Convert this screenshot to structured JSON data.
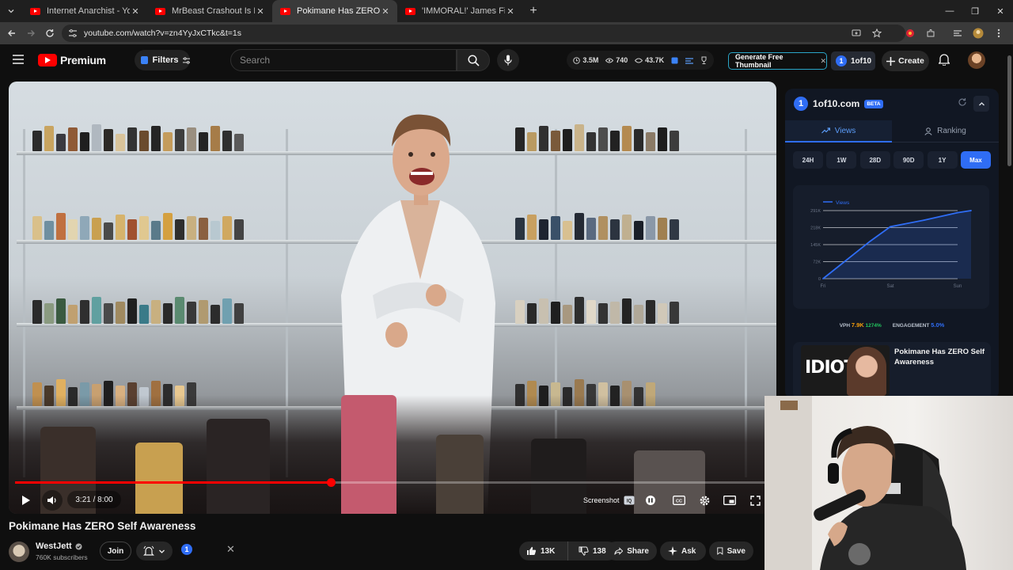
{
  "browser": {
    "tabs": [
      {
        "title": "Internet Anarchist - YouTube",
        "active": false
      },
      {
        "title": "MrBeast Crashout Is Hilarious -",
        "active": false
      },
      {
        "title": "Pokimane Has ZERO Self Aware",
        "active": true
      },
      {
        "title": "'IMMORAL!' James Fishback vs",
        "active": false
      }
    ],
    "url": "youtube.com/watch?v=zn4YyJxCTkc&t=1s"
  },
  "masthead": {
    "logo_text": "Premium",
    "filters_label": "Filters",
    "search_placeholder": "Search",
    "stats": {
      "views": "3.5M",
      "watching": "740",
      "likes": "43.7K"
    },
    "thumbnail_btn": "Generate Free Thumbnail",
    "oneof10_btn": "1of10",
    "create_label": "Create"
  },
  "player": {
    "time": "3:21 / 8:00",
    "progress_fraction": 0.418,
    "screenshot_label": "Screenshot"
  },
  "video": {
    "title": "Pokimane Has ZERO Self Awareness",
    "channel": "WestJett",
    "subscribers": "760K subscribers",
    "join_label": "Join",
    "oneof10_badge": "1",
    "likes": "13K",
    "dislikes": "138",
    "share_label": "Share",
    "ask_label": "Ask",
    "save_label": "Save"
  },
  "panel": {
    "brand": "1of10.com",
    "beta": "BETA",
    "tabs": [
      "Views",
      "Ranking"
    ],
    "ranges": [
      "24H",
      "1W",
      "28D",
      "90D",
      "1Y",
      "Max"
    ],
    "active_range": "Max",
    "vph_label": "VPH",
    "vph_value": "7.9K",
    "vph_pct": "1274%",
    "engagement_label": "ENGAGEMENT",
    "engagement_value": "5.0%",
    "rec_title": "Pokimane Has ZERO Self Awareness",
    "rec_thumb_text": "IDIOT"
  },
  "chart_data": {
    "type": "line",
    "legend": "Views",
    "categories": [
      "Fri",
      "Sat",
      "Sun"
    ],
    "y_ticks": [
      "0",
      "72K",
      "145K",
      "218K",
      "291K"
    ],
    "ylim": [
      0,
      291000
    ],
    "x": [
      0,
      0.7,
      1.0,
      1.5,
      2.0,
      2.2
    ],
    "values": [
      0,
      160000,
      222000,
      250000,
      282000,
      291000
    ],
    "color": "#2f6df5"
  },
  "colors": {
    "accent": "#2f6df5",
    "youtube_red": "#ff0000",
    "vph": "#f59e0b",
    "growth": "#22c55e"
  }
}
